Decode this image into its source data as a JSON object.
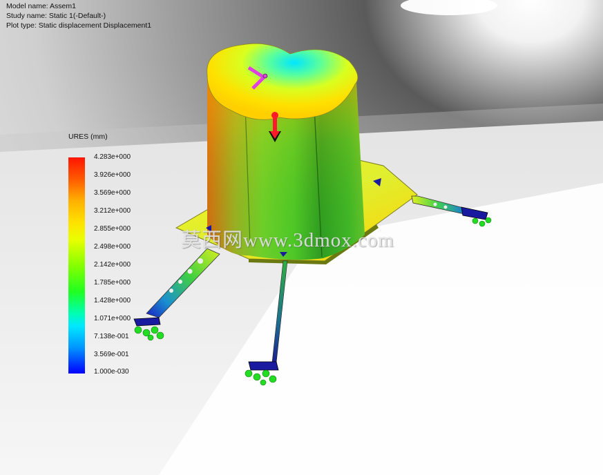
{
  "info": {
    "model_name": "Model name: Assem1",
    "study_name": "Study name: Static 1(-Default-)",
    "plot_type": "Plot type: Static displacement Displacement1"
  },
  "legend": {
    "title": "URES (mm)",
    "ticks": [
      "4.283e+000",
      "3.926e+000",
      "3.569e+000",
      "3.212e+000",
      "2.855e+000",
      "2.498e+000",
      "2.142e+000",
      "1.785e+000",
      "1.428e+000",
      "1.071e+000",
      "7.138e-001",
      "3.569e-001",
      "1.000e-030"
    ],
    "gradient_top": "#ff1400",
    "gradient_bottom": "#0000ff"
  },
  "watermark": "莫西网www.3dmox.com",
  "model": {
    "load_arrow_color": "#ff1a2a",
    "torque_arrow_color": "#e040e0",
    "fixture_color": "#22dd22",
    "foot_color": "#1a1aa0"
  }
}
